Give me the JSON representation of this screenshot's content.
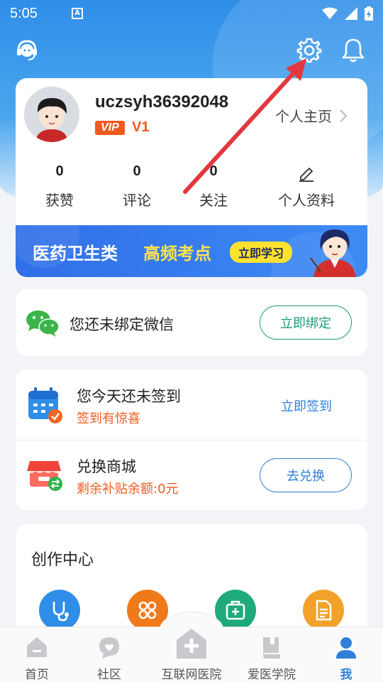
{
  "status_bar": {
    "time": "5:05",
    "notification_icon": "a-icon"
  },
  "header": {
    "service_icon": "headset-icon",
    "settings_icon": "gear-icon",
    "notifications_icon": "bell-icon"
  },
  "profile": {
    "username": "uczsyh36392048",
    "vip_label": "VIP",
    "vip_level": "V1",
    "homepage_label": "个人主页",
    "stats": [
      {
        "value": "0",
        "label": "获赞"
      },
      {
        "value": "0",
        "label": "评论"
      },
      {
        "value": "0",
        "label": "关注"
      }
    ],
    "edit_profile_label": "个人资料"
  },
  "banner": {
    "title": "医药卫生类",
    "highlight": "高频考点",
    "cta": "立即学习"
  },
  "wechat": {
    "text": "您还未绑定微信",
    "button": "立即绑定"
  },
  "tasks": {
    "checkin_title": "您今天还未签到",
    "checkin_sub": "签到有惊喜",
    "checkin_link": "立即签到",
    "mall_title": "兑换商城",
    "mall_sub": "剩余补贴余额:0元",
    "mall_button": "去兑换"
  },
  "create_center": {
    "title": "创作中心",
    "icons": [
      "stethoscope-icon",
      "grid-icon",
      "medical-case-icon",
      "document-icon"
    ]
  },
  "tabbar": {
    "tabs": [
      {
        "label": "首页",
        "icon": "home-icon"
      },
      {
        "label": "社区",
        "icon": "community-icon"
      },
      {
        "label": "互联网医院",
        "icon": "hospital-icon"
      },
      {
        "label": "爱医学院",
        "icon": "academy-icon"
      },
      {
        "label": "我",
        "icon": "user-icon"
      }
    ],
    "active": "我"
  },
  "colors": {
    "header_blue": "#2f8ee8",
    "accent_orange": "#ef5a1e",
    "accent_green": "#1e9c7a",
    "link_blue": "#2f7fd9"
  }
}
